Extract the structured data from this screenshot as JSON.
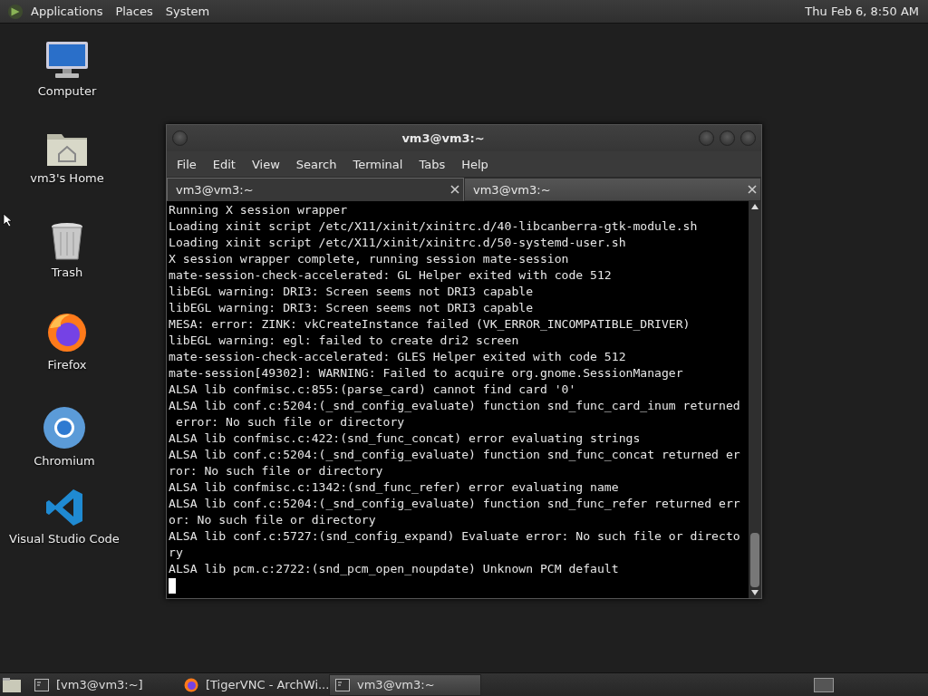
{
  "top_panel": {
    "menus": [
      "Applications",
      "Places",
      "System"
    ],
    "clock": "Thu Feb  6,  8:50 AM"
  },
  "desktop_icons": [
    {
      "label": "Computer",
      "kind": "computer"
    },
    {
      "label": "vm3's Home",
      "kind": "home"
    },
    {
      "label": "Trash",
      "kind": "trash"
    },
    {
      "label": "Firefox",
      "kind": "firefox"
    },
    {
      "label": "Chromium",
      "kind": "chromium"
    },
    {
      "label": "Visual Studio Code",
      "kind": "vscode"
    }
  ],
  "window": {
    "title": "vm3@vm3:~",
    "menu": [
      "File",
      "Edit",
      "View",
      "Search",
      "Terminal",
      "Tabs",
      "Help"
    ],
    "tabs": [
      {
        "label": "vm3@vm3:~",
        "selected": true
      },
      {
        "label": "vm3@vm3:~",
        "selected": false
      }
    ],
    "lines": [
      "Running X session wrapper",
      "Loading xinit script /etc/X11/xinit/xinitrc.d/40-libcanberra-gtk-module.sh",
      "Loading xinit script /etc/X11/xinit/xinitrc.d/50-systemd-user.sh",
      "X session wrapper complete, running session mate-session",
      "mate-session-check-accelerated: GL Helper exited with code 512",
      "libEGL warning: DRI3: Screen seems not DRI3 capable",
      "libEGL warning: DRI3: Screen seems not DRI3 capable",
      "MESA: error: ZINK: vkCreateInstance failed (VK_ERROR_INCOMPATIBLE_DRIVER)",
      "libEGL warning: egl: failed to create dri2 screen",
      "mate-session-check-accelerated: GLES Helper exited with code 512",
      "mate-session[49302]: WARNING: Failed to acquire org.gnome.SessionManager",
      "ALSA lib confmisc.c:855:(parse_card) cannot find card '0'",
      "ALSA lib conf.c:5204:(_snd_config_evaluate) function snd_func_card_inum returned",
      " error: No such file or directory",
      "ALSA lib confmisc.c:422:(snd_func_concat) error evaluating strings",
      "ALSA lib conf.c:5204:(_snd_config_evaluate) function snd_func_concat returned er",
      "ror: No such file or directory",
      "ALSA lib confmisc.c:1342:(snd_func_refer) error evaluating name",
      "ALSA lib conf.c:5204:(_snd_config_evaluate) function snd_func_refer returned err",
      "or: No such file or directory",
      "ALSA lib conf.c:5727:(snd_config_expand) Evaluate error: No such file or directo",
      "ry",
      "ALSA lib pcm.c:2722:(snd_pcm_open_noupdate) Unknown PCM default"
    ]
  },
  "taskbar": {
    "items": [
      {
        "label": "[vm3@vm3:~]",
        "kind": "terminal",
        "selected": false
      },
      {
        "label": "[TigerVNC - ArchWi...",
        "kind": "firefox",
        "selected": false
      },
      {
        "label": "vm3@vm3:~",
        "kind": "terminal",
        "selected": true
      }
    ]
  }
}
